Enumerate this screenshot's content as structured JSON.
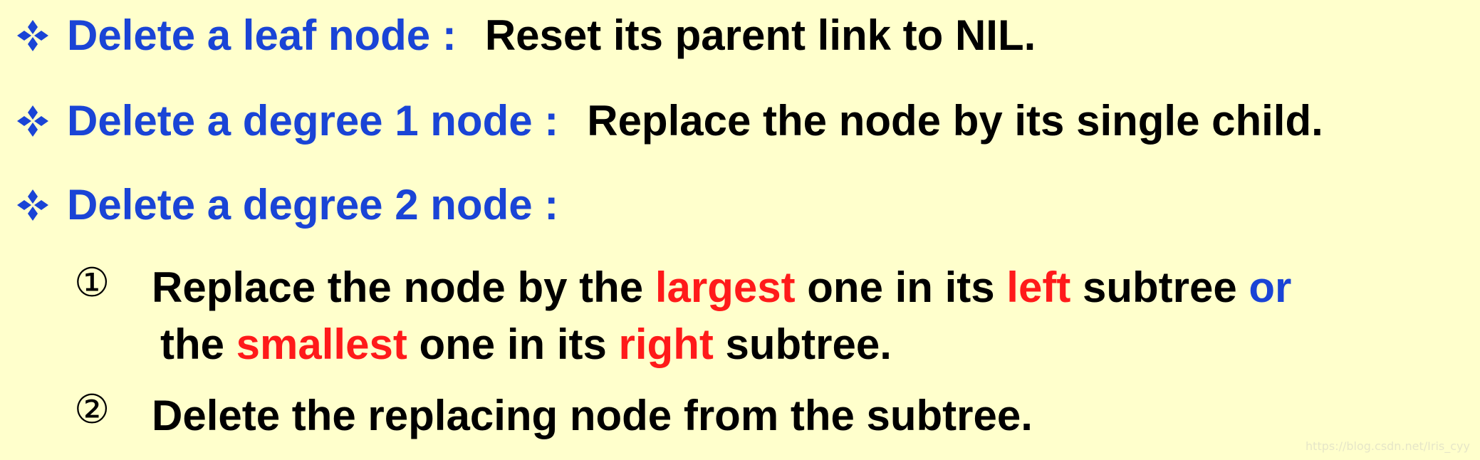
{
  "colors": {
    "background": "#ffffcc",
    "heading": "#1a44d6",
    "emphasis": "#ff1a1a",
    "text": "#000000"
  },
  "bullets": [
    {
      "icon": "four-diamond-bullet-icon",
      "heading": "Delete a leaf node :",
      "description": "Reset its parent link to NIL."
    },
    {
      "icon": "four-diamond-bullet-icon",
      "heading": "Delete a degree 1 node :",
      "description": "Replace the node by its single child."
    },
    {
      "icon": "four-diamond-bullet-icon",
      "heading": "Delete a degree 2 node :",
      "description": ""
    }
  ],
  "steps": [
    {
      "marker": "①",
      "line1": {
        "t1": "Replace the node by the ",
        "t2": "largest",
        "t3": " one in its ",
        "t4": "left",
        "t5": " subtree ",
        "t6": "or"
      },
      "line2": {
        "t1": "the ",
        "t2": "smallest",
        "t3": " one in its ",
        "t4": "right",
        "t5": " subtree."
      }
    },
    {
      "marker": "②",
      "text": "Delete the replacing node from the subtree."
    }
  ],
  "watermark": "https://blog.csdn.net/Iris_cyy"
}
